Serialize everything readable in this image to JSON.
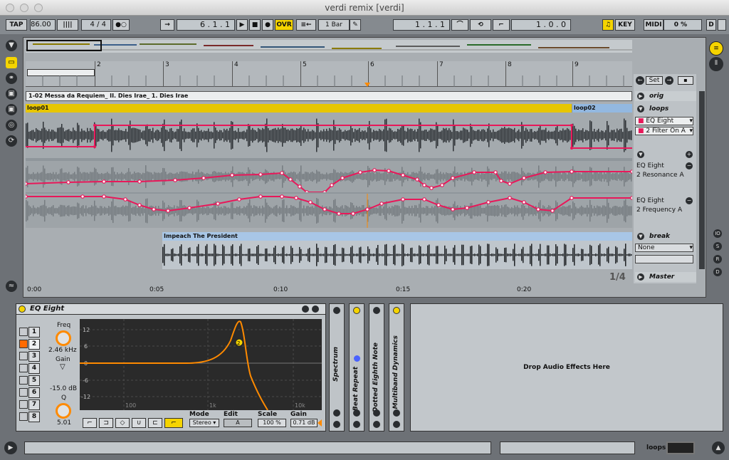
{
  "window": {
    "title": "verdi remix  [verdi]"
  },
  "control": {
    "tap": "TAP",
    "tempo": "86.00",
    "meter": "4 / 4",
    "position": "6 .  1 .  1",
    "ovr": "OVR",
    "quant": "1 Bar",
    "loop_start": "1 .  1 .  1",
    "loop_len": "1 .  0 .  0",
    "key": "KEY",
    "midi": "MIDI",
    "cpu": "0 %",
    "d": "D"
  },
  "ruler": {
    "bars": [
      "2",
      "3",
      "4",
      "5",
      "6",
      "7",
      "8",
      "9"
    ]
  },
  "timeline": {
    "labels": [
      "0:00",
      "0:05",
      "0:10",
      "0:15",
      "0:20"
    ],
    "zoom": "1/4"
  },
  "tracks": {
    "orig_title": "1-02 Messa da Requiem_ II. Dies Irae_ 1. Dies Irae",
    "orig_name": "orig",
    "loops_name": "loops",
    "clip1": "loop01",
    "clip2": "loop02",
    "device_select": "EQ Eight",
    "param_select": "2 Filter On A",
    "lane1_device": "EQ Eight",
    "lane1_param": "2 Resonance A",
    "lane2_device": "EQ Eight",
    "lane2_param": "2 Frequency A",
    "break_name": "break",
    "break_select": "None",
    "clip3": "Impeach The President",
    "master": "Master",
    "set": "Set"
  },
  "eq": {
    "title": "EQ Eight",
    "freq_label": "Freq",
    "freq_value": "2.46 kHz",
    "gain_label": "Gain",
    "gain_value": "-15.0 dB",
    "q_label": "Q",
    "q_value": "5.01",
    "bands": [
      "1",
      "2",
      "3",
      "4",
      "5",
      "6",
      "7",
      "8"
    ],
    "y_ticks": [
      "12",
      "6",
      "0",
      "-6",
      "-12"
    ],
    "x_ticks": [
      "100",
      "1k",
      "10k"
    ],
    "mode_label": "Mode",
    "mode_value": "Stereo",
    "edit_label": "Edit",
    "edit_value": "A",
    "scale_label": "Scale",
    "scale_value": "100 %",
    "gain2_label": "Gain",
    "gain2_value": "0.71 dB",
    "marker": "2"
  },
  "devices": [
    "Spectrum",
    "Beat Repeat",
    "Dotted Eighth Note",
    "Multiband Dynamics"
  ],
  "dropzone": "Drop Audio Effects Here",
  "status": {
    "track": "loops"
  },
  "colors": {
    "yellow": "#f5d400",
    "pink": "#e8185a",
    "orange": "#ff8a00",
    "blue": "#93b8e0"
  }
}
